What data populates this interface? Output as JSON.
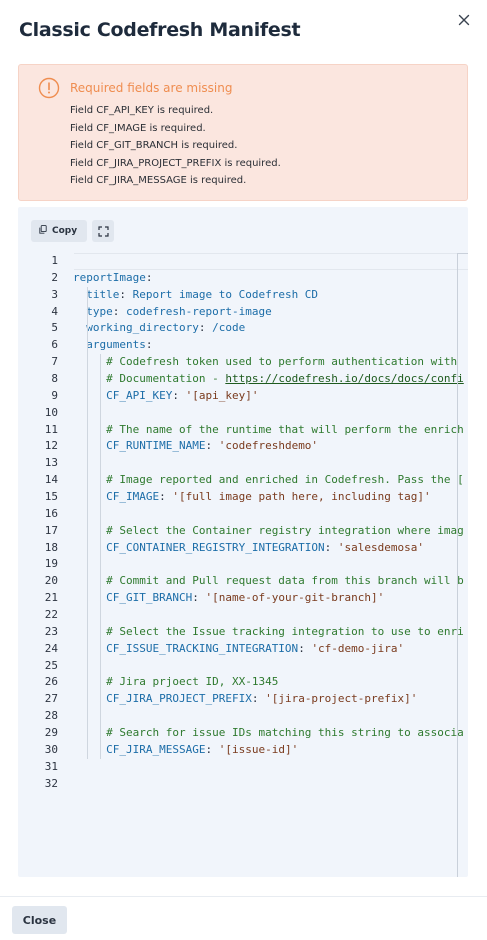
{
  "dialog": {
    "title": "Classic Codefresh Manifest",
    "close_icon": "close-icon"
  },
  "alert": {
    "icon": "warning-circle-icon",
    "title": "Required fields are missing",
    "color": "#ef8d50",
    "messages": [
      "Field CF_API_KEY is required.",
      "Field CF_IMAGE is required.",
      "Field CF_GIT_BRANCH is required.",
      "Field CF_JIRA_PROJECT_PREFIX is required.",
      "Field CF_JIRA_MESSAGE is required."
    ]
  },
  "toolbar": {
    "copy_label": "Copy",
    "copy_icon": "copy-icon",
    "expand_icon": "fullscreen-icon"
  },
  "editor": {
    "line_numbers": [
      "1",
      "2",
      "3",
      "4",
      "5",
      "6",
      "7",
      "8",
      "9",
      "10",
      "11",
      "12",
      "13",
      "14",
      "15",
      "16",
      "17",
      "18",
      "19",
      "20",
      "21",
      "22",
      "23",
      "24",
      "25",
      "26",
      "27",
      "28",
      "29",
      "30",
      "31",
      "32"
    ],
    "lines": [
      [],
      [
        {
          "t": "reportImage",
          "c": "k"
        },
        {
          "t": ":",
          "c": "p"
        }
      ],
      [
        {
          "t": "  "
        },
        {
          "t": "title",
          "c": "k"
        },
        {
          "t": ": ",
          "c": "p"
        },
        {
          "t": "Report image to Codefresh CD",
          "c": "v"
        }
      ],
      [
        {
          "t": "  "
        },
        {
          "t": "type",
          "c": "k"
        },
        {
          "t": ": ",
          "c": "p"
        },
        {
          "t": "codefresh-report-image",
          "c": "v"
        }
      ],
      [
        {
          "t": "  "
        },
        {
          "t": "working_directory",
          "c": "k"
        },
        {
          "t": ": ",
          "c": "p"
        },
        {
          "t": "/code",
          "c": "v"
        }
      ],
      [
        {
          "t": "  "
        },
        {
          "t": "arguments",
          "c": "k"
        },
        {
          "t": ":",
          "c": "p"
        }
      ],
      [
        {
          "t": "     "
        },
        {
          "t": "# Codefresh token used to perform authentication with",
          "c": "c"
        }
      ],
      [
        {
          "t": "     "
        },
        {
          "t": "# Documentation - ",
          "c": "c"
        },
        {
          "t": "https://codefresh.io/docs/docs/confi",
          "c": "u"
        }
      ],
      [
        {
          "t": "     "
        },
        {
          "t": "CF_API_KEY",
          "c": "k"
        },
        {
          "t": ": ",
          "c": "p"
        },
        {
          "t": "'[api_key]'",
          "c": "s"
        }
      ],
      [],
      [
        {
          "t": "     "
        },
        {
          "t": "# The name of the runtime that will perform the enrich",
          "c": "c"
        }
      ],
      [
        {
          "t": "     "
        },
        {
          "t": "CF_RUNTIME_NAME",
          "c": "k"
        },
        {
          "t": ": ",
          "c": "p"
        },
        {
          "t": "'codefreshdemo'",
          "c": "s"
        }
      ],
      [],
      [
        {
          "t": "     "
        },
        {
          "t": "# Image reported and enriched in Codefresh. Pass the [",
          "c": "c"
        }
      ],
      [
        {
          "t": "     "
        },
        {
          "t": "CF_IMAGE",
          "c": "k"
        },
        {
          "t": ": ",
          "c": "p"
        },
        {
          "t": "'[full image path here, including tag]'",
          "c": "s"
        }
      ],
      [],
      [
        {
          "t": "     "
        },
        {
          "t": "# Select the Container registry integration where imag",
          "c": "c"
        }
      ],
      [
        {
          "t": "     "
        },
        {
          "t": "CF_CONTAINER_REGISTRY_INTEGRATION",
          "c": "k"
        },
        {
          "t": ": ",
          "c": "p"
        },
        {
          "t": "'salesdemosa'",
          "c": "s"
        }
      ],
      [],
      [
        {
          "t": "     "
        },
        {
          "t": "# Commit and Pull request data from this branch will b",
          "c": "c"
        }
      ],
      [
        {
          "t": "     "
        },
        {
          "t": "CF_GIT_BRANCH",
          "c": "k"
        },
        {
          "t": ": ",
          "c": "p"
        },
        {
          "t": "'[name-of-your-git-branch]'",
          "c": "s"
        }
      ],
      [],
      [
        {
          "t": "     "
        },
        {
          "t": "# Select the Issue tracking integration to use to enri",
          "c": "c"
        }
      ],
      [
        {
          "t": "     "
        },
        {
          "t": "CF_ISSUE_TRACKING_INTEGRATION",
          "c": "k"
        },
        {
          "t": ": ",
          "c": "p"
        },
        {
          "t": "'cf-demo-jira'",
          "c": "s"
        }
      ],
      [],
      [
        {
          "t": "     "
        },
        {
          "t": "# Jira prjoect ID, XX-1345",
          "c": "c"
        }
      ],
      [
        {
          "t": "     "
        },
        {
          "t": "CF_JIRA_PROJECT_PREFIX",
          "c": "k"
        },
        {
          "t": ": ",
          "c": "p"
        },
        {
          "t": "'[jira-project-prefix]'",
          "c": "s"
        }
      ],
      [],
      [
        {
          "t": "     "
        },
        {
          "t": "# Search for issue IDs matching this string to associa",
          "c": "c"
        }
      ],
      [
        {
          "t": "     "
        },
        {
          "t": "CF_JIRA_MESSAGE",
          "c": "k"
        },
        {
          "t": ": ",
          "c": "p"
        },
        {
          "t": "'[issue-id]'",
          "c": "s"
        }
      ],
      [],
      []
    ]
  },
  "footer": {
    "close_label": "Close"
  }
}
